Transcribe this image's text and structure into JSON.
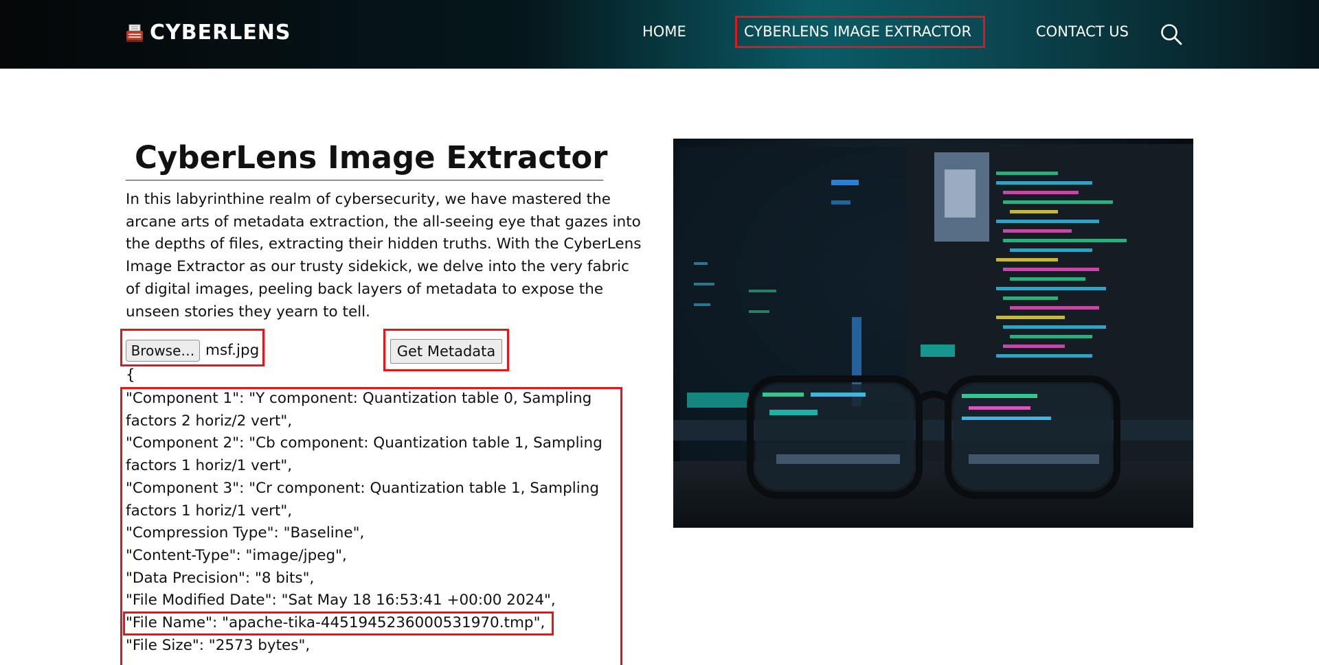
{
  "brand": {
    "name": "CYBERLENS",
    "icon": "typewriter-icon"
  },
  "nav": {
    "items": [
      {
        "label": "HOME"
      },
      {
        "label": "CYBERLENS IMAGE EXTRACTOR"
      },
      {
        "label": "CONTACT US"
      }
    ],
    "search_icon": "search-icon"
  },
  "main": {
    "title": "CyberLens Image Extractor",
    "intro": "In this labyrinthine realm of cybersecurity, we have mastered the arcane arts of metadata extraction, the all-seeing eye that gazes into the depths of files, extracting their hidden truths. With the CyberLens Image Extractor as our trusty sidekick, we delve into the very fabric of digital images, peeling back layers of metadata to expose the unseen stories they yearn to tell.",
    "browse_label": "Browse…",
    "file_name": "msf.jpg",
    "get_metadata_label": "Get Metadata",
    "json_open": "{",
    "metadata_lines": [
      "\"Component 1\": \"Y component: Quantization table 0, Sampling factors 2 horiz/2 vert\",",
      "\"Component 2\": \"Cb component: Quantization table 1, Sampling factors 1 horiz/1 vert\",",
      "\"Component 3\": \"Cr component: Quantization table 1, Sampling factors 1 horiz/1 vert\",",
      "\"Compression Type\": \"Baseline\",",
      "\"Content-Type\": \"image/jpeg\",",
      "\"Data Precision\": \"8 bits\",",
      "\"File Modified Date\": \"Sat May 18 16:53:41 +00:00 2024\",",
      "\"File Name\": \"apache-tika-4451945236000531970.tmp\",",
      "\"File Size\": \"2573 bytes\","
    ]
  },
  "colors": {
    "highlight": "#e8141c",
    "nav_accent": "#0a5b66"
  }
}
